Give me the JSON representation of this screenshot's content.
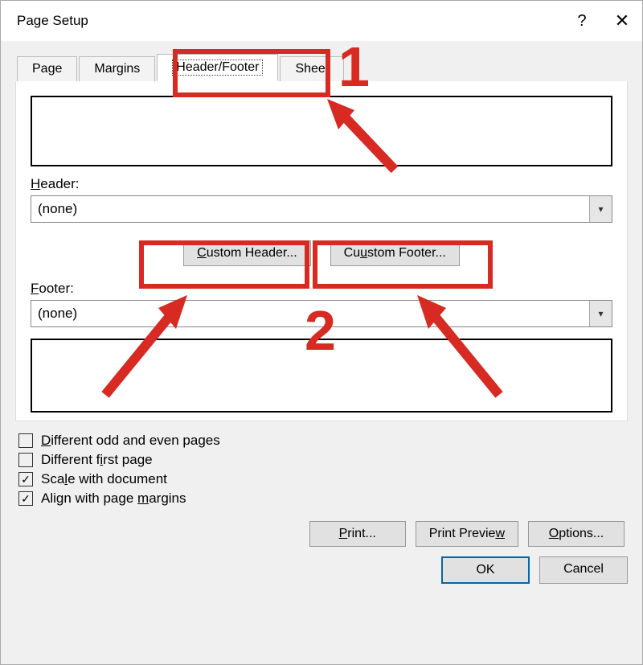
{
  "window": {
    "title": "Page Setup",
    "help_symbol": "?",
    "close_symbol": "✕"
  },
  "tabs": {
    "page": "Page",
    "margins": "Margins",
    "headerfooter": "Header/Footer",
    "sheet": "Sheet"
  },
  "labels": {
    "header": "eader:",
    "header_prefix": "H",
    "footer": "ooter:",
    "footer_prefix": "F",
    "none": "(none)"
  },
  "buttons": {
    "custom_header": "ustom Header...",
    "custom_header_prefix": "C",
    "custom_footer": "stom Footer...",
    "custom_footer_prefix": "Cu",
    "print": "rint...",
    "print_prefix": "P",
    "print_preview": "Print Previe",
    "print_preview_suffix": "w",
    "options": "ptions...",
    "options_prefix": "O",
    "ok": "OK",
    "cancel": "Cancel"
  },
  "checkboxes": {
    "diff_odd_even_prefix": "D",
    "diff_odd_even": "ifferent odd and even pages",
    "diff_first_prefix": "Different f",
    "diff_first_key": "i",
    "diff_first_suffix": "rst page",
    "scale_prefix": "Sca",
    "scale_key": "l",
    "scale_suffix": "e with document",
    "align_prefix": "Align with page ",
    "align_key": "m",
    "align_suffix": "argins"
  },
  "annotations": {
    "num1": "1",
    "num2": "2"
  }
}
